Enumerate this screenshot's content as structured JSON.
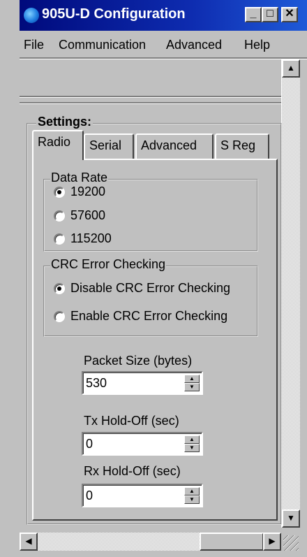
{
  "window": {
    "title": "905U-D Configuration",
    "minimize_glyph": "_",
    "maximize_glyph": "□",
    "close_glyph": "✕"
  },
  "menu": [
    "File",
    "Communication",
    "Advanced",
    "Help"
  ],
  "settings": {
    "label": "Settings:",
    "tabs": [
      "Radio",
      "Serial",
      "Advanced",
      "S Reg"
    ],
    "active_tab": "Radio"
  },
  "radio_tab": {
    "data_rate": {
      "label": "Data Rate",
      "options": [
        "19200",
        "57600",
        "115200"
      ],
      "selected": "19200"
    },
    "crc": {
      "label": "CRC Error Checking",
      "options": [
        "Disable CRC Error Checking",
        "Enable CRC Error Checking"
      ],
      "selected": "Disable CRC Error Checking"
    },
    "packet_size": {
      "label": "Packet Size (bytes)",
      "value": "530"
    },
    "tx_holdoff": {
      "label": "Tx Hold-Off (sec)",
      "value": "0"
    },
    "rx_holdoff": {
      "label": "Rx Hold-Off (sec)",
      "value": "0"
    }
  },
  "scrollbar_glyphs": {
    "up": "▲",
    "down": "▼",
    "left": "◀",
    "right": "▶"
  },
  "colors": {
    "title_bar": "#000a7c",
    "face": "#c0c0c0"
  }
}
